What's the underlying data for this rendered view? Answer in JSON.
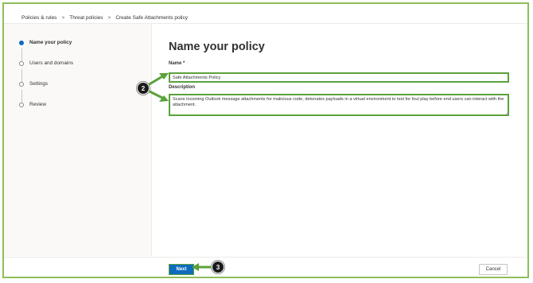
{
  "breadcrumb": {
    "items": [
      "Policies & rules",
      "Threat policies",
      "Create Safe Attachments policy"
    ],
    "separator": ">"
  },
  "steps": [
    {
      "label": "Name your policy",
      "active": true
    },
    {
      "label": "Users and domains",
      "active": false
    },
    {
      "label": "Settings",
      "active": false
    },
    {
      "label": "Review",
      "active": false
    }
  ],
  "page": {
    "title": "Name your policy",
    "name_label": "Name *",
    "name_value": "Safe Attachments Policy",
    "description_label": "Description",
    "description_value": "Scans incoming Outlook message attachments for malicious code, detonates payloads in a virtual environment to test for foul play before end users can interact with the attachment."
  },
  "footer": {
    "next_label": "Next",
    "cancel_label": "Cancel"
  },
  "callouts": {
    "fields_badge": "2",
    "next_badge": "3"
  },
  "colors": {
    "accent": "#0f6cbd",
    "highlight": "#5aa23a"
  }
}
